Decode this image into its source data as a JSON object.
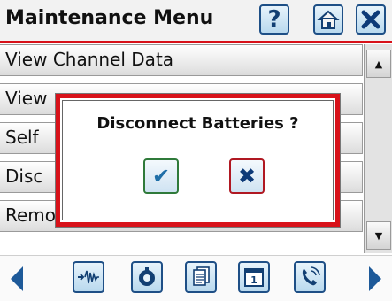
{
  "header": {
    "title": "Maintenance Menu",
    "help_label": "?"
  },
  "menu": {
    "items": [
      {
        "label": "View Channel Data"
      },
      {
        "label": "View"
      },
      {
        "label": "Self"
      },
      {
        "label": "Disc"
      },
      {
        "label": "Remove Offsets Now"
      }
    ]
  },
  "scrollbar": {
    "up": "▲",
    "down": "▼"
  },
  "dialog": {
    "message": "Disconnect Batteries ?",
    "confirm": "✔",
    "cancel": "✖"
  },
  "toolbar": {
    "icons": [
      "waveform-icon",
      "gauge-icon",
      "documents-icon",
      "calendar-icon",
      "phone-icon"
    ],
    "calendar_day": "1"
  },
  "colors": {
    "accent_red": "#d8121a",
    "icon_blue": "#1e4f86",
    "confirm_green": "#2f7a3a"
  }
}
